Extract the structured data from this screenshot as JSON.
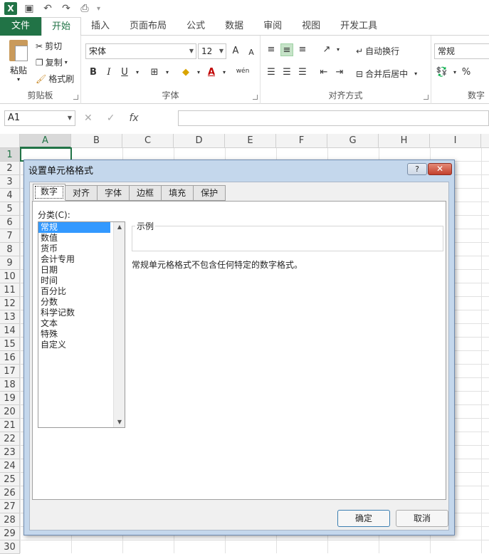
{
  "qat": {
    "app_icon": "X"
  },
  "ribbon_tabs": [
    "文件",
    "开始",
    "插入",
    "页面布局",
    "公式",
    "数据",
    "审阅",
    "视图",
    "开发工具"
  ],
  "clipboard": {
    "paste": "粘贴",
    "cut": "剪切",
    "copy": "复制",
    "format_painter": "格式刷",
    "label": "剪贴板"
  },
  "font": {
    "name": "宋体",
    "size": "12",
    "label": "字体",
    "bold": "B",
    "italic": "I",
    "underline": "U",
    "grow": "A",
    "shrink": "A",
    "color": "A",
    "pinyin": "wén"
  },
  "alignment": {
    "wrap": "自动换行",
    "merge": "合并后居中",
    "label": "对齐方式"
  },
  "number": {
    "format": "常规",
    "label": "数字",
    "percent": "%"
  },
  "formula_bar": {
    "name_box": "A1",
    "fx": "fx",
    "value": ""
  },
  "columns": [
    "A",
    "B",
    "C",
    "D",
    "E",
    "F",
    "G",
    "H",
    "I"
  ],
  "rows": [
    "1",
    "2",
    "3",
    "4",
    "5",
    "6",
    "7",
    "8",
    "9",
    "10",
    "11",
    "12",
    "13",
    "14",
    "15",
    "16",
    "17",
    "18",
    "19",
    "20",
    "21",
    "22",
    "23",
    "24",
    "25",
    "26",
    "27",
    "28",
    "29",
    "30"
  ],
  "dialog": {
    "title": "设置单元格格式",
    "help": "?",
    "close": "✕",
    "tabs": [
      "数字",
      "对齐",
      "字体",
      "边框",
      "填充",
      "保护"
    ],
    "category_label": "分类(C):",
    "categories": [
      "常规",
      "数值",
      "货币",
      "会计专用",
      "日期",
      "时间",
      "百分比",
      "分数",
      "科学记数",
      "文本",
      "特殊",
      "自定义"
    ],
    "sample_label": "示例",
    "description": "常规单元格格式不包含任何特定的数字格式。",
    "ok": "确定",
    "cancel": "取消"
  }
}
